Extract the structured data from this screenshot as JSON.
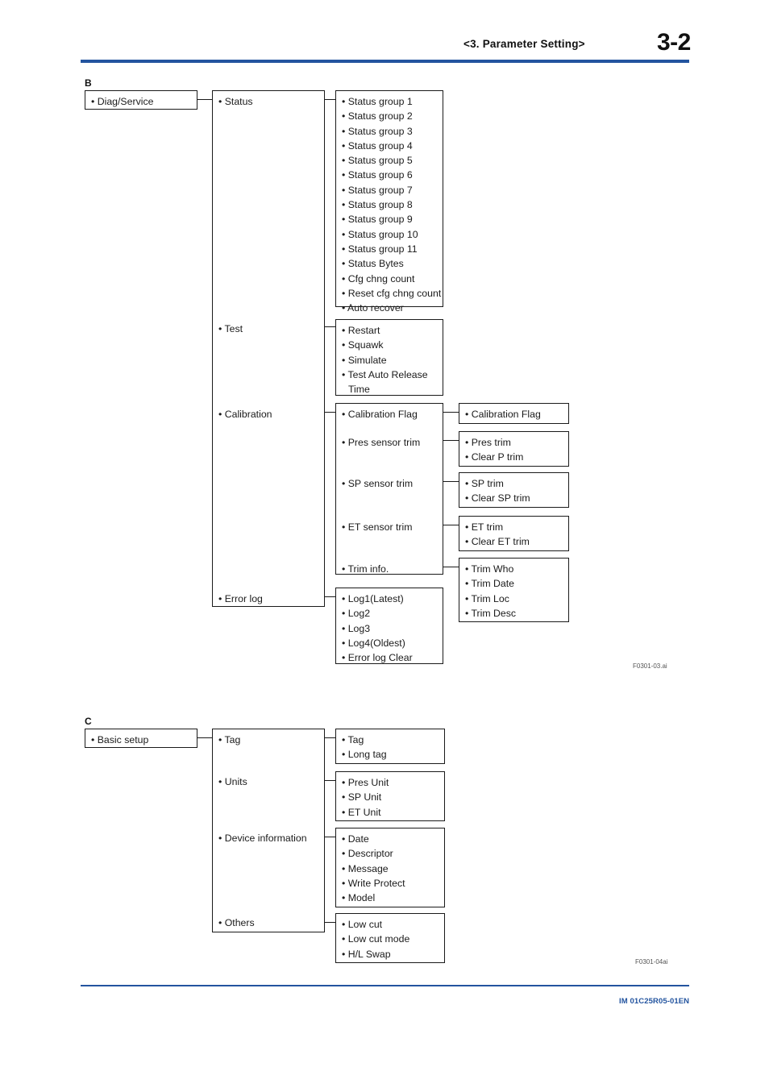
{
  "header": {
    "section_title": "<3.  Parameter Setting>",
    "page_number": "3-2"
  },
  "footer": {
    "doc_code": "IM 01C25R05-01EN"
  },
  "figures": [
    {
      "label": "B",
      "code": "F0301-03.ai",
      "root": "• Diag/Service",
      "level2": [
        "• Status",
        "• Test",
        "• Calibration",
        "• Error log"
      ],
      "status_items": [
        "• Status group 1",
        "• Status group 2",
        "• Status group 3",
        "• Status group 4",
        "• Status group 5",
        "• Status group 6",
        "• Status group 7",
        "• Status group 8",
        "• Status group 9",
        "• Status group 10",
        "• Status group 11",
        "• Status Bytes",
        "• Cfg chng count",
        "• Reset cfg chng count",
        "• Auto recover"
      ],
      "test_items": [
        "• Restart",
        "• Squawk",
        "• Simulate",
        "• Test Auto Release",
        "Time"
      ],
      "calibration_items": [
        "• Calibration Flag",
        "• Pres sensor trim",
        "• SP sensor trim",
        "• ET sensor trim",
        "• Trim info."
      ],
      "calibration_leaf_groups": [
        {
          "items": [
            "• Calibration Flag"
          ]
        },
        {
          "items": [
            "• Pres trim",
            "• Clear P trim"
          ]
        },
        {
          "items": [
            "• SP trim",
            "• Clear SP trim"
          ]
        },
        {
          "items": [
            "• ET trim",
            "• Clear ET trim"
          ]
        },
        {
          "items": [
            "• Trim Who",
            "• Trim Date",
            "• Trim Loc",
            "• Trim Desc"
          ]
        }
      ],
      "error_log_items": [
        "• Log1(Latest)",
        "• Log2",
        "• Log3",
        "• Log4(Oldest)",
        "• Error log Clear"
      ]
    },
    {
      "label": "C",
      "code": "F0301-04ai",
      "root": "• Basic setup",
      "level2": [
        "• Tag",
        "• Units",
        "• Device information",
        "• Others"
      ],
      "leaf_groups": [
        {
          "items": [
            "• Tag",
            "• Long tag"
          ]
        },
        {
          "items": [
            "• Pres Unit",
            "• SP Unit",
            "• ET Unit"
          ]
        },
        {
          "items": [
            "• Date",
            "• Descriptor",
            "• Message",
            "• Write Protect",
            "• Model"
          ]
        },
        {
          "items": [
            "• Low cut",
            "• Low cut mode",
            "• H/L Swap"
          ]
        }
      ]
    }
  ],
  "colors": {
    "rule_blue": "#23549f",
    "text": "#1a1a1a",
    "figure_code": "#555555"
  }
}
